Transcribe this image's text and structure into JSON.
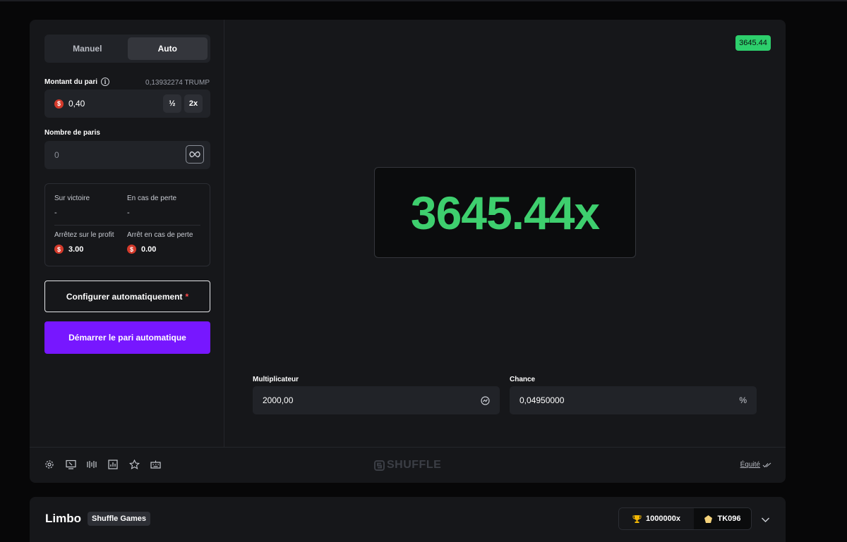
{
  "mode_tabs": {
    "manual": "Manuel",
    "auto": "Auto",
    "active": "auto"
  },
  "bet": {
    "label": "Montant du pari",
    "balance": "0,13932274 TRUMP",
    "currency_symbol": "$",
    "amount": "0,40",
    "half_label": "½",
    "double_label": "2x"
  },
  "num_bets": {
    "label": "Nombre de paris",
    "value": "0"
  },
  "strategy": {
    "on_win_label": "Sur victoire",
    "on_win_value": "-",
    "on_loss_label": "En cas de perte",
    "on_loss_value": "-",
    "stop_profit_label": "Arrêtez sur le profit",
    "stop_profit_value": "3.00",
    "stop_loss_label": "Arrêt en cas de perte",
    "stop_loss_value": "0.00"
  },
  "buttons": {
    "configure": "Configurer automatiquement",
    "configure_required": "*",
    "start": "Démarrer le pari automatique"
  },
  "game": {
    "last_result": "3645.44",
    "result_display": "3645.44x",
    "result_color": "#3ecf6e",
    "multiplier_label": "Multiplicateur",
    "multiplier_value": "2000,00",
    "chance_label": "Chance",
    "chance_value": "0,04950000",
    "chance_suffix": "%"
  },
  "footer": {
    "icons": [
      "settings-icon",
      "theatre-mode-icon",
      "sound-icon",
      "stats-icon",
      "favorite-icon",
      "hotkeys-icon"
    ],
    "brand": "SHUFFLE",
    "fairness": "Équité"
  },
  "info_bar": {
    "title": "Limbo",
    "provider": "Shuffle Games",
    "max_win": "1000000x",
    "top_player": "TK096"
  },
  "colors": {
    "accent": "#7717ff",
    "win_green": "#2dcf6c",
    "coin_red": "#d43a2b"
  }
}
